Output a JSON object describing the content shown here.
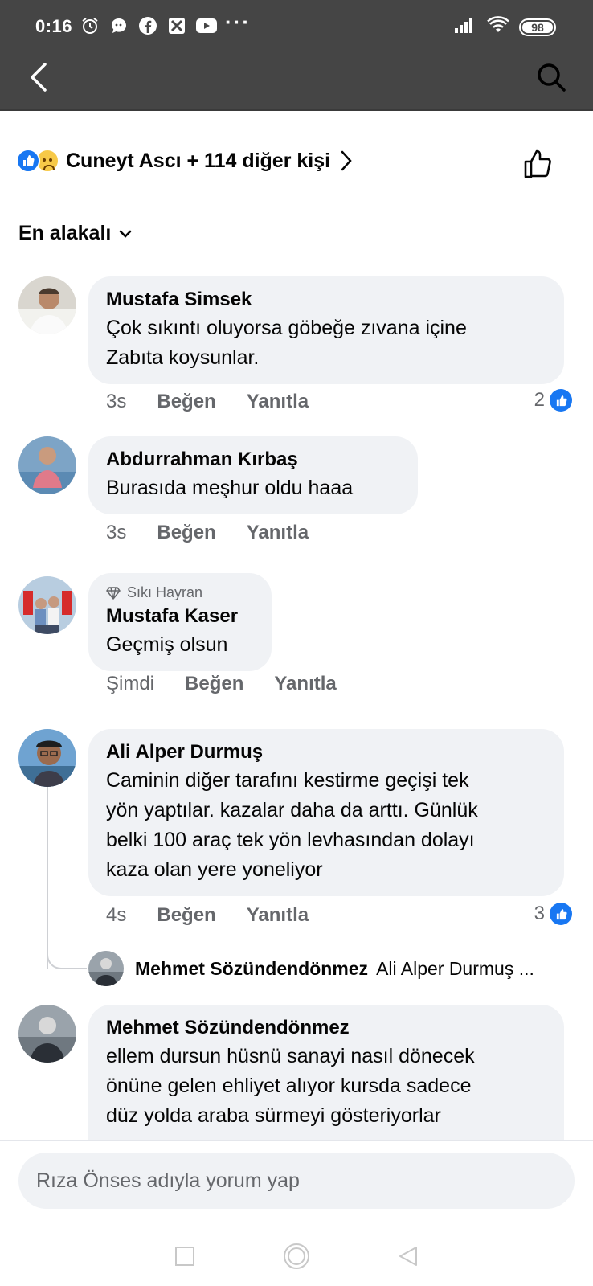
{
  "status_bar": {
    "time": "0:16",
    "more_indicator": "···",
    "battery": "98",
    "icons": [
      "alarm-icon",
      "chat-icon",
      "facebook-icon",
      "app-icon",
      "youtube-icon",
      "signal-icon",
      "wifi-icon"
    ]
  },
  "header": {
    "back_icon": "back-icon",
    "search_icon": "search-icon"
  },
  "reactions": {
    "text": "Cuneyt Ascı + 114 diğer kişi",
    "icons": [
      "like-icon",
      "sad-icon"
    ]
  },
  "sort": {
    "label": "En alakalı"
  },
  "comments": [
    {
      "name": "Mustafa Simsek",
      "text_lines": [
        "Çok sıkıntı oluyorsa göbeğe zıvana içine",
        "Zabıta koysunlar."
      ],
      "time": "3s",
      "like_label": "Beğen",
      "reply_label": "Yanıtla",
      "reaction_count": "2"
    },
    {
      "name": "Abdurrahman Kırbaş",
      "text_lines": [
        "Burasıda meşhur oldu haaa"
      ],
      "time": "3s",
      "like_label": "Beğen",
      "reply_label": "Yanıtla"
    },
    {
      "badge": "Sıkı Hayran",
      "name": "Mustafa Kaser",
      "text_lines": [
        "Geçmiş olsun"
      ],
      "time": "Şimdi",
      "like_label": "Beğen",
      "reply_label": "Yanıtla"
    },
    {
      "name": "Ali Alper Durmuş",
      "text_lines": [
        "Caminin diğer tarafını kestirme geçişi tek",
        "yön yaptılar. kazalar daha da arttı. Günlük",
        "belki 100 araç tek yön levhasından dolayı",
        "kaza olan yere yoneliyor"
      ],
      "time": "4s",
      "like_label": "Beğen",
      "reply_label": "Yanıtla",
      "reaction_count": "3",
      "reply": {
        "name": "Mehmet Sözündendönmez",
        "text": "Ali Alper Durmuş ..."
      }
    },
    {
      "name": "Mehmet Sözündendönmez",
      "text_lines": [
        "ellem dursun hüsnü sanayi nasıl dönecek",
        "önüne gelen ehliyet alıyor kursda sadece",
        "düz yolda araba sürmeyi gösteriyorlar"
      ]
    }
  ],
  "composer": {
    "placeholder": "Rıza Önses adıyla yorum yap"
  },
  "colors": {
    "accent": "#1877f2",
    "bubble": "#f0f2f5",
    "header": "#454545",
    "secondary_text": "#65676b"
  }
}
